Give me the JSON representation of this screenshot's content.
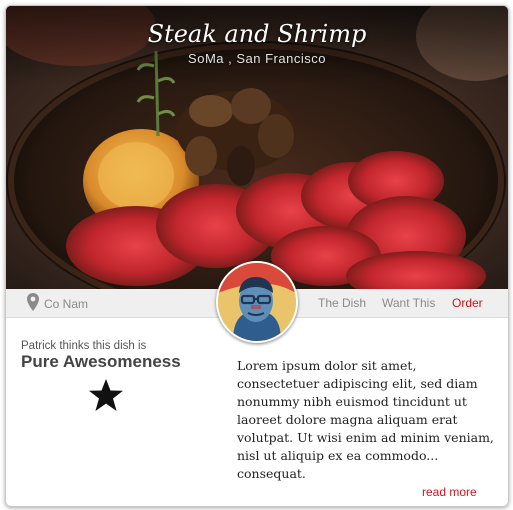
{
  "hero": {
    "title": "Steak and Shrimp",
    "subtitle": "SoMa , San Francisco"
  },
  "info_bar": {
    "location_icon": "map-pin-icon",
    "location_label": "Co Nam",
    "tabs": [
      {
        "label": "The Dish"
      },
      {
        "label": "Want This"
      },
      {
        "label": "Order",
        "color": "#c8161a"
      }
    ]
  },
  "review": {
    "thinks_text": "Patrick thinks this dish is",
    "verdict": "Pure Awesomeness",
    "rating_icon": "star-icon",
    "rating_stars": 1,
    "description": "Lorem ipsum dolor sit amet, consectetuer adipiscing elit, sed diam nonummy nibh euismod tincidunt ut laoreet dolore magna aliquam erat volutpat. Ut wisi enim ad minim veniam,  nisl ut aliquip ex ea commodo... consequat.",
    "read_more": "read more"
  },
  "colors": {
    "accent": "#c8161a",
    "muted_text": "#8a8a8a",
    "bar_bg": "#efefef"
  }
}
